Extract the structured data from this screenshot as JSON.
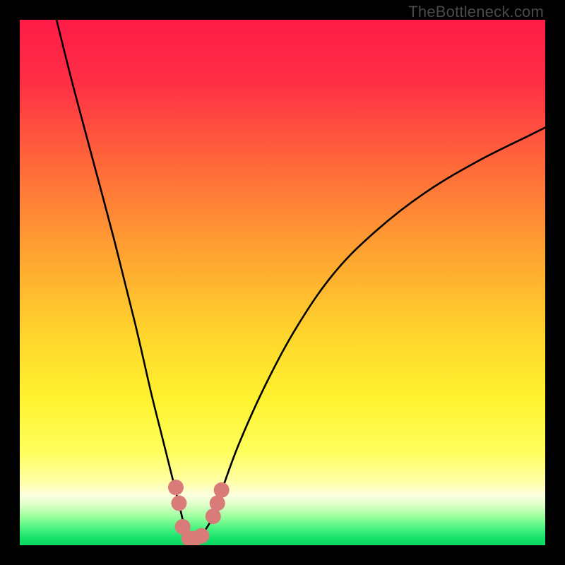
{
  "watermark": "TheBottleneck.com",
  "chart_data": {
    "type": "line",
    "title": "",
    "xlabel": "",
    "ylabel": "",
    "xlim": [
      0,
      100
    ],
    "ylim": [
      0,
      100
    ],
    "series": [
      {
        "name": "bottleneck-curve",
        "x": [
          7,
          10,
          14,
          18,
          22,
          25,
          27,
          29,
          30.5,
          31.5,
          32.5,
          33.5,
          35,
          37,
          39,
          42,
          47,
          53,
          60,
          68,
          77,
          87,
          97,
          100
        ],
        "y": [
          100,
          88,
          73,
          58,
          42,
          29,
          21,
          13,
          7,
          3,
          1.2,
          1.2,
          2.5,
          6,
          12,
          20,
          31,
          42,
          52,
          60,
          67,
          73,
          78,
          79.5
        ]
      }
    ],
    "markers": {
      "name": "highlight-dots",
      "color": "#d87b79",
      "points": [
        {
          "x": 29.7,
          "y": 11.0
        },
        {
          "x": 30.3,
          "y": 8.0
        },
        {
          "x": 31.0,
          "y": 3.5
        },
        {
          "x": 32.2,
          "y": 1.3
        },
        {
          "x": 33.4,
          "y": 1.3
        },
        {
          "x": 34.6,
          "y": 1.8
        },
        {
          "x": 36.8,
          "y": 5.5
        },
        {
          "x": 37.6,
          "y": 8.0
        },
        {
          "x": 38.4,
          "y": 10.5
        }
      ]
    },
    "background_gradient": {
      "stops": [
        {
          "pos": 0.0,
          "color": "#ff1b47"
        },
        {
          "pos": 0.12,
          "color": "#ff2f45"
        },
        {
          "pos": 0.28,
          "color": "#ff6a3a"
        },
        {
          "pos": 0.45,
          "color": "#ffa531"
        },
        {
          "pos": 0.6,
          "color": "#ffd52c"
        },
        {
          "pos": 0.72,
          "color": "#fff22f"
        },
        {
          "pos": 0.82,
          "color": "#ffff5a"
        },
        {
          "pos": 0.88,
          "color": "#ffffa8"
        },
        {
          "pos": 0.905,
          "color": "#fdffe0"
        },
        {
          "pos": 0.925,
          "color": "#d8ffc4"
        },
        {
          "pos": 0.945,
          "color": "#9dff9e"
        },
        {
          "pos": 0.965,
          "color": "#55f585"
        },
        {
          "pos": 0.985,
          "color": "#18e36c"
        },
        {
          "pos": 1.0,
          "color": "#08d85f"
        }
      ]
    }
  }
}
